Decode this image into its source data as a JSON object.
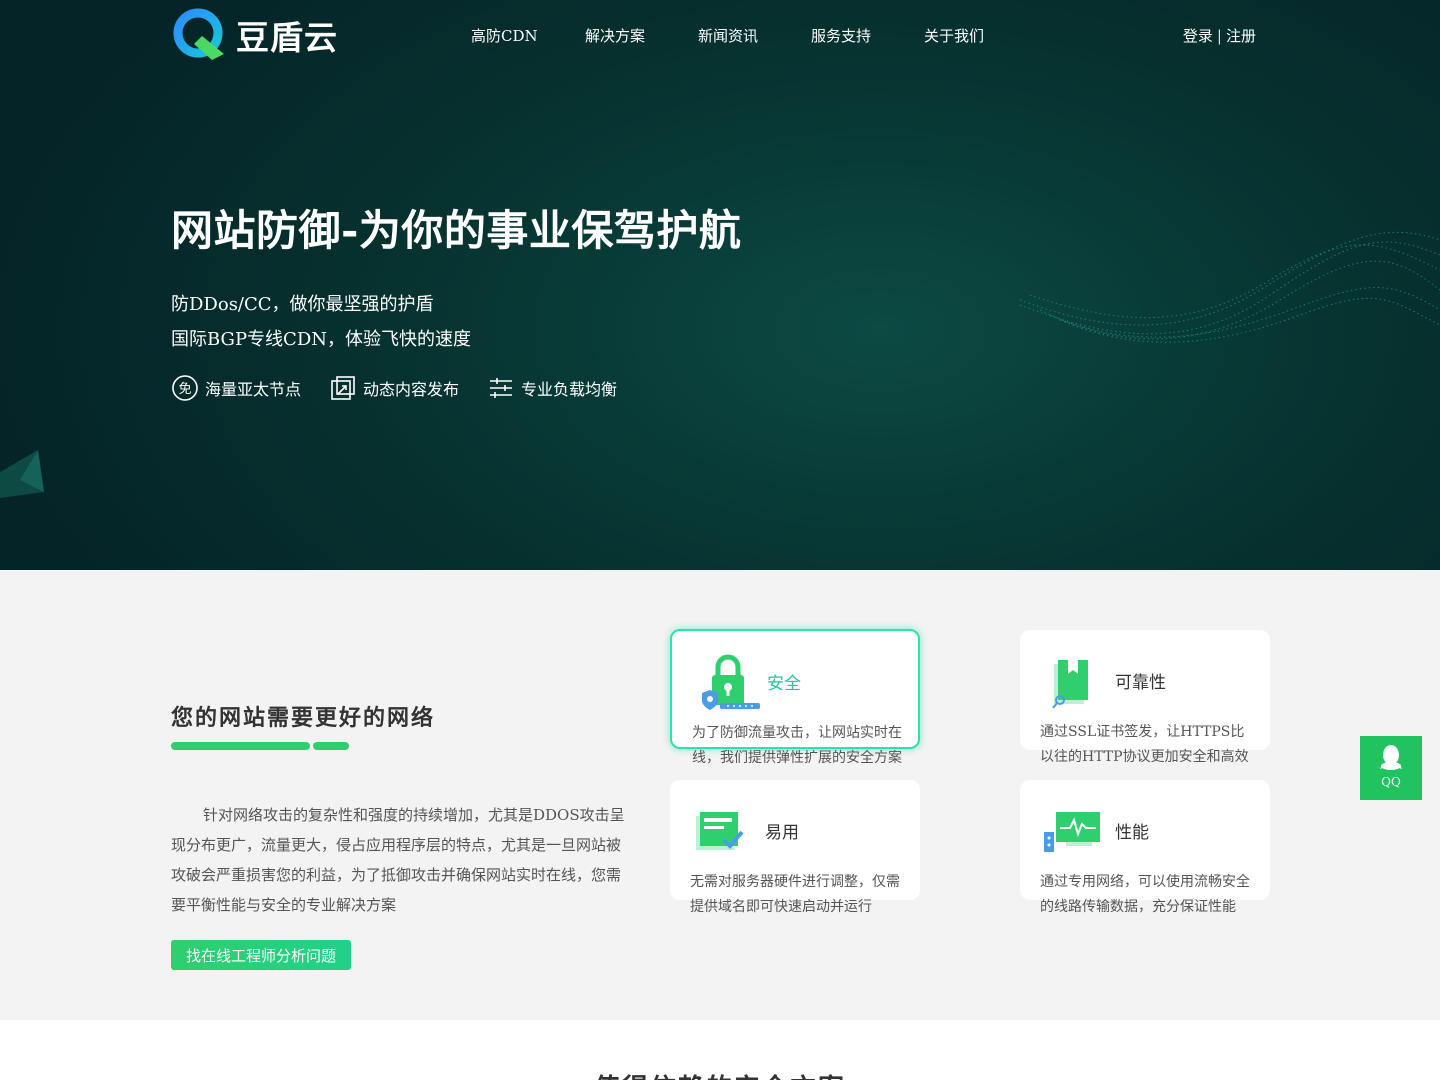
{
  "brand": {
    "name": "豆盾云"
  },
  "nav": {
    "items": [
      {
        "label": "高防CDN"
      },
      {
        "label": "解决方案"
      },
      {
        "label": "新闻资讯"
      },
      {
        "label": "服务支持"
      },
      {
        "label": "关于我们"
      }
    ]
  },
  "auth": {
    "login": "登录",
    "separator": "|",
    "register": "注册"
  },
  "hero": {
    "title": "网站防御-为你的事业保驾护航",
    "subtitle1": "防DDos/CC，做你最坚强的护盾",
    "subtitle2": "国际BGP专线CDN，体验飞快的速度",
    "features": [
      {
        "label": "海量亚太节点",
        "icon": "free-badge-icon"
      },
      {
        "label": "动态内容发布",
        "icon": "publish-icon"
      },
      {
        "label": "专业负载均衡",
        "icon": "sliders-icon"
      }
    ]
  },
  "section2": {
    "title": "您的网站需要更好的网络",
    "description": "针对网络攻击的复杂性和强度的持续增加，尤其是DDOS攻击呈现分布更广，流量更大，侵占应用程序层的特点，尤其是一旦网站被攻破会严重损害您的利益，为了抵御攻击并确保网站实时在线，您需要平衡性能与安全的专业解决方案",
    "cta": "找在线工程师分析问题",
    "cards": [
      {
        "title": "安全",
        "desc": "为了防御流量攻击，让网站实时在线，我们提供弹性扩展的安全方案",
        "icon": "lock-icon"
      },
      {
        "title": "可靠性",
        "desc": "通过SSL证书签发，让HTTPS比以往的HTTP协议更加安全和高效",
        "icon": "certificate-icon"
      },
      {
        "title": "易用",
        "desc": "无需对服务器硬件进行调整，仅需提供域名即可快速启动并运行",
        "icon": "browser-check-icon"
      },
      {
        "title": "性能",
        "desc": "通过专用网络，可以使用流畅安全的线路传输数据，充分保证性能",
        "icon": "monitor-pulse-icon"
      }
    ]
  },
  "float": {
    "qq": "QQ"
  },
  "section3": {
    "title": "值得信赖的安全方案"
  },
  "colors": {
    "accent": "#2fcf6e",
    "hero_bg": "#06302e",
    "active_card": "#21c6a0"
  }
}
